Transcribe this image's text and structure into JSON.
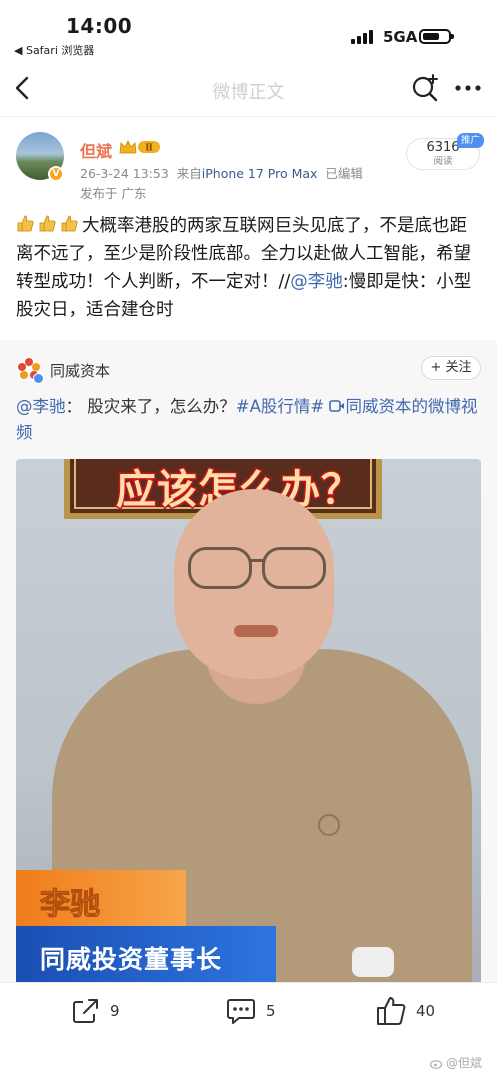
{
  "status_bar": {
    "time": "14:00",
    "back_app": "◀ Safari 浏览器",
    "network": "5GA"
  },
  "nav": {
    "title": "微博正文",
    "icons": [
      "back-arrow-icon",
      "search-plus-icon",
      "more-icon"
    ]
  },
  "post": {
    "author": "但斌",
    "vip_badge": "Ⅱ",
    "avatar_badge": "V",
    "datetime": "26-3-24 13:53",
    "source_prefix": "来自",
    "device": "iPhone 17 Pro Max",
    "edited": "已编辑",
    "location": "发布于 广东",
    "read_count": "6316",
    "read_label": "阅读",
    "promo_tag": "推广",
    "body_main": "大概率港股的两家互联网巨头见底了，不是底也距离不远了，至少是阶段性底部。全力以赴做人工智能，希望转型成功！个人判断，不一定对！",
    "body_repost_prefix": "//",
    "body_mention": "@李驰",
    "body_quote": ":慢即是快：小型股灾日，适合建仓时"
  },
  "repost": {
    "source_name": "同威资本",
    "follow_label": "+ 关注",
    "mention": "@李驰",
    "text": "： 股灾来了，怎么办？",
    "hashtag": "#A股行情#",
    "video_link": "同威资本的微博视频",
    "video": {
      "headline": "应该怎么办？",
      "caption_name": "李驰",
      "caption_title": "同威投资董事长"
    }
  },
  "actions": {
    "repost_count": "9",
    "comment_count": "5",
    "like_count": "40"
  },
  "watermark": "@但斌",
  "colors": {
    "author": "#eb7350",
    "link": "#4169ad",
    "promo": "#4e8ff0"
  }
}
